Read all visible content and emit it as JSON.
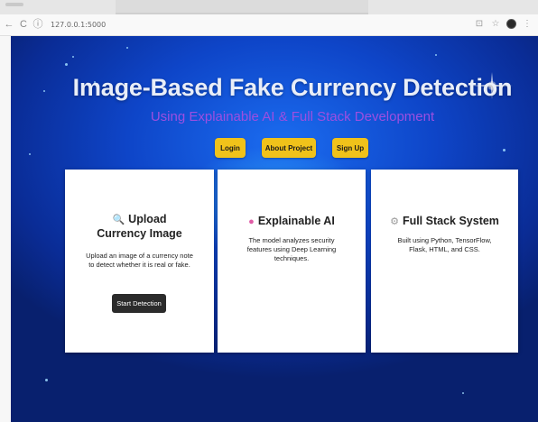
{
  "browser": {
    "url": "127.0.0.1:5000",
    "back_icon": "back-arrow-icon",
    "forward_icon": "reload-icon",
    "info_icon": "site-info-icon"
  },
  "hero": {
    "title": "Image-Based Fake Currency Detection",
    "subtitle": "Using Explainable AI & Full Stack Development"
  },
  "nav_buttons": {
    "login": "Login",
    "about": "About Project",
    "signup": "Sign Up"
  },
  "cards": [
    {
      "icon": "magnifier-icon",
      "icon_glyph": "🔍",
      "title": "Upload Currency Image",
      "description": "Upload an image of a currency note to detect whether it is real or fake.",
      "button": "Start Detection"
    },
    {
      "icon": "brain-icon",
      "icon_glyph": "●",
      "title": "Explainable AI",
      "description": "The model analyzes security features using Deep Learning techniques."
    },
    {
      "icon": "gear-icon",
      "icon_glyph": "⚙",
      "title": "Full Stack System",
      "description": "Built using Python, TensorFlow, Flask, HTML, and CSS."
    }
  ],
  "colors": {
    "accent_button": "#f0c21a",
    "subtitle": "#9c4fe0",
    "background": "#0e45c8"
  }
}
